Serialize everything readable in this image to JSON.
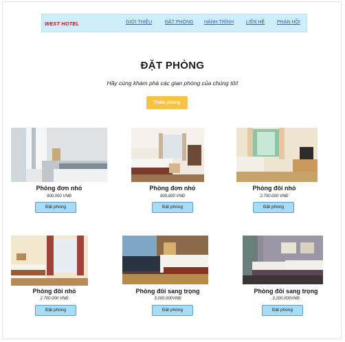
{
  "navbar": {
    "brand": "WEST HOTEL",
    "links": [
      "GIỚI THIỆU",
      "ĐẶT PHÒNG",
      "HÀNH TRÌNH",
      "LIÊN HỆ",
      "PHẢN HỒI"
    ]
  },
  "header": {
    "title": "ĐẶT PHÒNG",
    "subtitle": "Hãy cùng khám phá các gian phòng của chúng tôi!",
    "add_button": "Thêm phòng"
  },
  "rooms": [
    {
      "name": "Phòng đơn nhỏ",
      "price": "900.000 VNĐ",
      "button": "Đặt phòng"
    },
    {
      "name": "Phòng đơn nhỏ",
      "price": "900.000 VNĐ",
      "button": "Đặt phòng"
    },
    {
      "name": "Phòng đôi nhỏ",
      "price": "2.700.000 VNĐ",
      "button": "Đặt phòng"
    },
    {
      "name": "Phòng đôi nhỏ",
      "price": "2.700.000 VNĐ",
      "button": "Đặt phòng"
    },
    {
      "name": "Phòng đôi sang trọng",
      "price": "3.200.000VNĐ",
      "button": "Đặt phòng"
    },
    {
      "name": "Phòng đôi sang trọng",
      "price": "3.200.000VNĐ",
      "button": "Đặt phòng"
    }
  ],
  "colors": {
    "navbar_bg": "#cfeefb",
    "brand": "#b01919",
    "nav_link": "#3a4ee0",
    "add_button": "#f6c445",
    "book_button": "#a7dcf6"
  }
}
